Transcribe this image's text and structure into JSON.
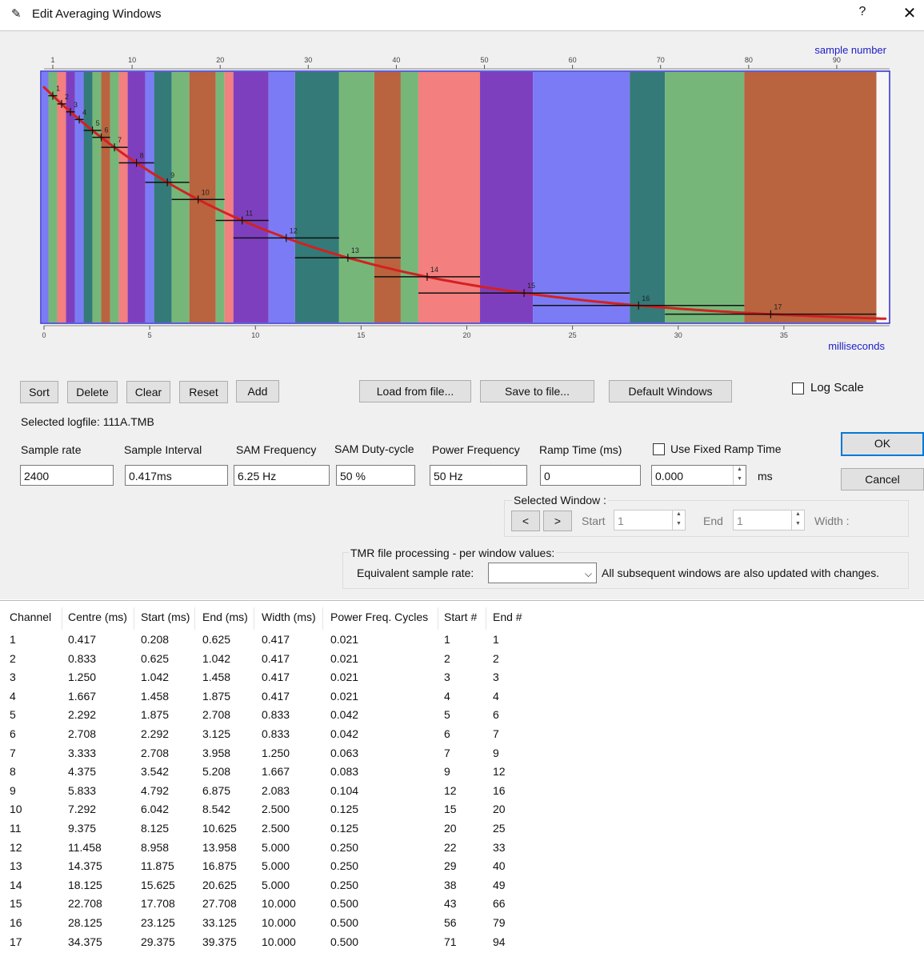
{
  "window": {
    "title": "Edit Averaging Windows",
    "help_label": "?",
    "close_label": "✕"
  },
  "chart_data": {
    "type": "area",
    "top_axis_label": "sample number",
    "bottom_axis_label": "milliseconds",
    "top_ticks": [
      1,
      10,
      20,
      30,
      40,
      50,
      60,
      70,
      80,
      90
    ],
    "bottom_ticks": [
      0,
      5,
      10,
      15,
      20,
      25,
      30,
      35
    ],
    "x_range_ms": [
      0,
      40
    ],
    "window_color_cycle": [
      "#76b779",
      "#f47f7f",
      "#7e3fbf",
      "#7b7cf5",
      "#337a78",
      "#76b779",
      "#b9633f"
    ],
    "windows": [
      {
        "label": "1",
        "centre": 0.417,
        "start": 0.208,
        "end": 0.625
      },
      {
        "label": "2",
        "centre": 0.833,
        "start": 0.625,
        "end": 1.042
      },
      {
        "label": "3",
        "centre": 1.25,
        "start": 1.042,
        "end": 1.458
      },
      {
        "label": "4",
        "centre": 1.667,
        "start": 1.458,
        "end": 1.875
      },
      {
        "label": "5",
        "centre": 2.292,
        "start": 1.875,
        "end": 2.708
      },
      {
        "label": "6",
        "centre": 2.708,
        "start": 2.292,
        "end": 3.125
      },
      {
        "label": "7",
        "centre": 3.333,
        "start": 2.708,
        "end": 3.958
      },
      {
        "label": "8",
        "centre": 4.375,
        "start": 3.542,
        "end": 5.208
      },
      {
        "label": "9",
        "centre": 5.833,
        "start": 4.792,
        "end": 6.875
      },
      {
        "label": "10",
        "centre": 7.292,
        "start": 6.042,
        "end": 8.542
      },
      {
        "label": "11",
        "centre": 9.375,
        "start": 8.125,
        "end": 10.625
      },
      {
        "label": "12",
        "centre": 11.458,
        "start": 8.958,
        "end": 13.958
      },
      {
        "label": "13",
        "centre": 14.375,
        "start": 11.875,
        "end": 16.875
      },
      {
        "label": "14",
        "centre": 18.125,
        "start": 15.625,
        "end": 20.625
      },
      {
        "label": "15",
        "centre": 22.708,
        "start": 17.708,
        "end": 27.708
      },
      {
        "label": "16",
        "centre": 28.125,
        "start": 23.125,
        "end": 33.125
      },
      {
        "label": "17",
        "centre": 34.375,
        "start": 29.375,
        "end": 39.375
      }
    ]
  },
  "buttons": {
    "sort": "Sort",
    "delete": "Delete",
    "clear": "Clear",
    "reset": "Reset",
    "add": "Add",
    "load": "Load from file...",
    "save": "Save to file...",
    "default_windows": "Default Windows",
    "ok": "OK",
    "cancel": "Cancel"
  },
  "log_scale": {
    "label": "Log Scale",
    "checked": false
  },
  "selected_logfile": "Selected logfile: 111A.TMB",
  "fields": {
    "sample_rate": {
      "label": "Sample rate",
      "value": "2400"
    },
    "sample_interval": {
      "label": "Sample Interval",
      "value": "0.417ms"
    },
    "sam_frequency": {
      "label": "SAM Frequency",
      "value": "6.25 Hz"
    },
    "sam_duty": {
      "label": "SAM Duty-cycle",
      "value": "50 %"
    },
    "power_frequency": {
      "label": "Power Frequency",
      "value": "50 Hz"
    },
    "ramp_time": {
      "label": "Ramp Time (ms)",
      "value": "0"
    },
    "fixed_ramp": {
      "label": "Use Fixed Ramp Time",
      "checked": false,
      "value": "0.000",
      "unit": "ms"
    }
  },
  "selected_window": {
    "label": "Selected Window :",
    "prev": "<",
    "next": ">",
    "start_label": "Start",
    "start_value": "1",
    "end_label": "End",
    "end_value": "1",
    "width_label": "Width :"
  },
  "tmr": {
    "label": "TMR file processing - per window values:",
    "eq_label": "Equivalent sample rate:",
    "eq_value": "",
    "note": "All subsequent windows are also updated with changes."
  },
  "table": {
    "columns": [
      "Channel",
      "Centre (ms)",
      "Start (ms)",
      "End (ms)",
      "Width (ms)",
      "Power Freq. Cycles",
      "Start #",
      "End #"
    ],
    "rows": [
      [
        "1",
        "0.417",
        "0.208",
        "0.625",
        "0.417",
        "0.021",
        "1",
        "1"
      ],
      [
        "2",
        "0.833",
        "0.625",
        "1.042",
        "0.417",
        "0.021",
        "2",
        "2"
      ],
      [
        "3",
        "1.250",
        "1.042",
        "1.458",
        "0.417",
        "0.021",
        "3",
        "3"
      ],
      [
        "4",
        "1.667",
        "1.458",
        "1.875",
        "0.417",
        "0.021",
        "4",
        "4"
      ],
      [
        "5",
        "2.292",
        "1.875",
        "2.708",
        "0.833",
        "0.042",
        "5",
        "6"
      ],
      [
        "6",
        "2.708",
        "2.292",
        "3.125",
        "0.833",
        "0.042",
        "6",
        "7"
      ],
      [
        "7",
        "3.333",
        "2.708",
        "3.958",
        "1.250",
        "0.063",
        "7",
        "9"
      ],
      [
        "8",
        "4.375",
        "3.542",
        "5.208",
        "1.667",
        "0.083",
        "9",
        "12"
      ],
      [
        "9",
        "5.833",
        "4.792",
        "6.875",
        "2.083",
        "0.104",
        "12",
        "16"
      ],
      [
        "10",
        "7.292",
        "6.042",
        "8.542",
        "2.500",
        "0.125",
        "15",
        "20"
      ],
      [
        "11",
        "9.375",
        "8.125",
        "10.625",
        "2.500",
        "0.125",
        "20",
        "25"
      ],
      [
        "12",
        "11.458",
        "8.958",
        "13.958",
        "5.000",
        "0.250",
        "22",
        "33"
      ],
      [
        "13",
        "14.375",
        "11.875",
        "16.875",
        "5.000",
        "0.250",
        "29",
        "40"
      ],
      [
        "14",
        "18.125",
        "15.625",
        "20.625",
        "5.000",
        "0.250",
        "38",
        "49"
      ],
      [
        "15",
        "22.708",
        "17.708",
        "27.708",
        "10.000",
        "0.500",
        "43",
        "66"
      ],
      [
        "16",
        "28.125",
        "23.125",
        "33.125",
        "10.000",
        "0.500",
        "56",
        "79"
      ],
      [
        "17",
        "34.375",
        "29.375",
        "39.375",
        "10.000",
        "0.500",
        "71",
        "94"
      ]
    ]
  }
}
